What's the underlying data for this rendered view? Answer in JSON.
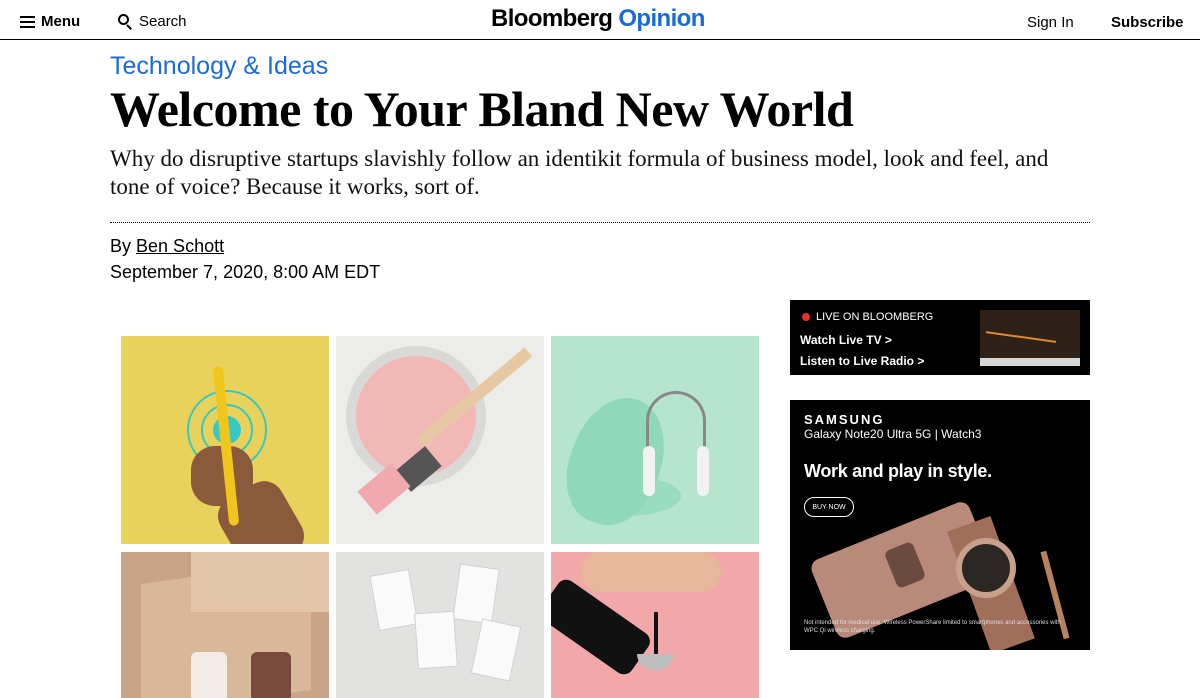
{
  "header": {
    "menu_label": "Menu",
    "search_label": "Search",
    "logo_brand": "Bloomberg",
    "logo_section": "Opinion",
    "signin_label": "Sign In",
    "subscribe_label": "Subscribe"
  },
  "article": {
    "kicker": "Technology & Ideas",
    "headline": "Welcome to Your Bland New World",
    "dek": "Why do disruptive startups slavishly follow an identikit formula of business model, look and feel, and tone of voice? Because it works, sort of.",
    "byline_prefix": "By",
    "author": "Ben Schott",
    "date": "September 7, 2020, 8:00 AM EDT"
  },
  "live": {
    "label": "LIVE ON BLOOMBERG",
    "tv_label": "Watch Live TV",
    "radio_label": "Listen to Live Radio",
    "chevron": ">"
  },
  "ad": {
    "brand": "SAMSUNG",
    "product": "Galaxy Note20 Ultra 5G | Watch3",
    "headline": "Work and play in style.",
    "cta": "BUY NOW",
    "fineprint": "Not intended for medical use. Wireless PowerShare limited to smartphones and accessories with WPC Qi wireless charging."
  },
  "colors": {
    "accent_blue": "#1a6bd8",
    "live_red": "#e8312c"
  },
  "icons": {
    "menu": "hamburger-icon",
    "search": "search-icon",
    "live": "red-dot-icon",
    "chevron": "chevron-right-icon"
  }
}
